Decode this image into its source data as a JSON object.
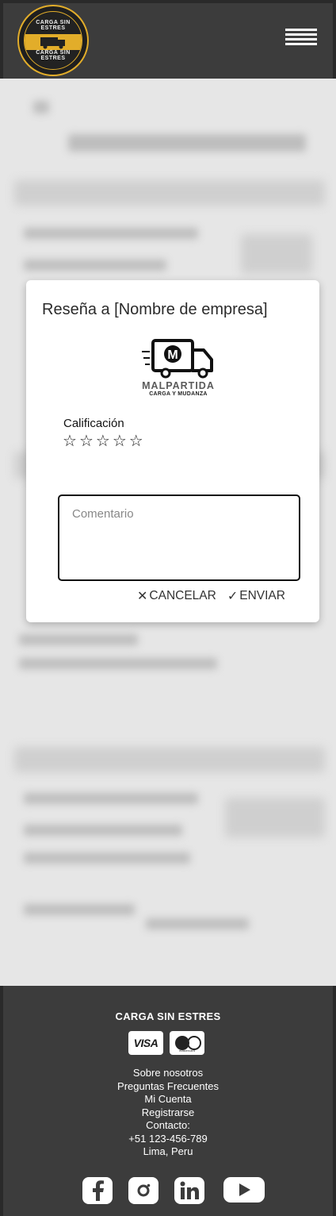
{
  "header": {
    "logo_top_text": "CARGA SIN ESTRES",
    "logo_bottom_text": "CARGA SIN ESTRES"
  },
  "modal": {
    "title": "Reseña a  [Nombre de empresa]",
    "brand_name": "MALPARTIDA",
    "brand_subtitle": "CARGA Y MUDANZA",
    "rating_label": "Calificación",
    "stars": [
      "☆",
      "☆",
      "☆",
      "☆",
      "☆"
    ],
    "comment_placeholder": "Comentario",
    "cancel_label": "CANCELAR",
    "send_label": "ENVIAR"
  },
  "footer": {
    "brand": "CARGA SIN ESTRES",
    "visa_label": "VISA",
    "mastercard_label": "mastercard",
    "links": [
      "Sobre nosotros",
      "Preguntas Frecuentes",
      "Mi Cuenta",
      "Registrarse"
    ],
    "contact_label": "Contacto:",
    "phone": "+51 123-456-789",
    "location": "Lima, Peru"
  },
  "colors": {
    "header_bg": "#3c3c3c",
    "accent_gold": "#e2ad2a",
    "overlay_bg": "#e6e6e6"
  }
}
